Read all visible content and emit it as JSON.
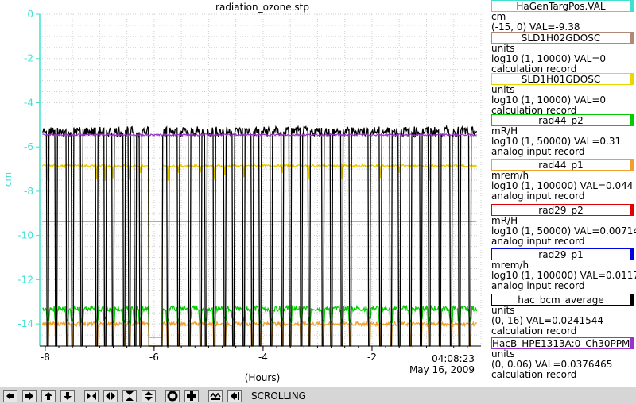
{
  "chart_data": {
    "type": "line",
    "title": "radiation_ozone.stp",
    "xlabel": "(Hours)",
    "ylabel": "cm",
    "xlim": [
      -8.1,
      0
    ],
    "ylim": [
      -15,
      0
    ],
    "x_ticks": [
      -8,
      -6,
      -4,
      -2
    ],
    "x_tick_labels": [
      "-8",
      "-6",
      "-4",
      "-2"
    ],
    "y_ticks": [
      0,
      -2,
      -4,
      -6,
      -8,
      -10,
      -12,
      -14
    ],
    "y_tick_labels": [
      "0",
      "-2",
      "-4",
      "-6",
      "-8",
      "-10",
      "-12",
      "-14"
    ],
    "axis_color": "#40e0d0",
    "end_time": "04:08:23",
    "end_date": "May 16, 2009",
    "grid": true,
    "legend_placement": "right",
    "drop_times": [
      -7.95,
      -7.8,
      -7.6,
      -7.5,
      -7.33,
      -7.05,
      -6.9,
      -6.75,
      -6.55,
      -6.45,
      -6.35,
      -6.25,
      -5.75,
      -5.55,
      -5.35,
      -5.15,
      -5.05,
      -4.9,
      -4.7,
      -4.55,
      -4.35,
      -4.2,
      -4.05,
      -3.85,
      -3.65,
      -3.5,
      -3.3,
      -3.15,
      -2.9,
      -2.75,
      -2.55,
      -2.4,
      -2.05,
      -1.85,
      -1.65,
      -1.5,
      -1.3,
      -1.1,
      -0.95,
      -0.75,
      -0.55,
      -0.4,
      -0.2
    ],
    "off_period": [
      -6.1,
      -5.85
    ],
    "series": [
      {
        "name": "HaGenTargPos.VAL",
        "color": "#40e0d0",
        "level": -9.38
      },
      {
        "name": "rad44_p2",
        "color": "#00cc00",
        "level": -13.3,
        "drop_level": -14.6
      },
      {
        "name": "rad44_p1",
        "color": "#f0a030",
        "level": -14.0,
        "drop_level": -15.0
      },
      {
        "name": "rad29_p2",
        "color": "#e8c800",
        "level": -6.85,
        "drop_level": -15.0
      },
      {
        "name": "hac_bcm_average",
        "color": "#000000",
        "level": -5.3,
        "drop_level": -15.0
      },
      {
        "name": "HacB_HPE1313A:0_Ch30PPM",
        "color": "#9933cc",
        "level": -5.45
      }
    ]
  },
  "legend": [
    {
      "name": "HaGenTargPos.VAL",
      "color": "#40e0d0",
      "units": "cm",
      "range": "(-15, 0) VAL=-9.38",
      "record": ""
    },
    {
      "name": "SLD1H02GDOSC",
      "color": "#b08878",
      "units": "units",
      "range": "log10 (1, 10000)  VAL=0",
      "record": "calculation record"
    },
    {
      "name": "SLD1H01GDOSC",
      "color": "#e8d800",
      "units": "units",
      "range": "log10 (1, 10000)  VAL=0",
      "record": "calculation record"
    },
    {
      "name": "rad44_p2",
      "color": "#00cc00",
      "units": "mR/H",
      "range": "log10 (1, 50000) VAL=0.31",
      "record": "analog input record"
    },
    {
      "name": "rad44_p1",
      "color": "#f0a030",
      "units": "mrem/h",
      "range": "log10 (1, 100000) VAL=0.044",
      "record": "analog input record"
    },
    {
      "name": "rad29_p2",
      "color": "#e00000",
      "units": "mR/H",
      "range": "log10 (1, 50000) VAL=0.00714",
      "record": "analog input record"
    },
    {
      "name": "rad29_p1",
      "color": "#0000e0",
      "units": "mrem/h",
      "range": "log10 (1, 100000) VAL=0.0117",
      "record": "analog input record"
    },
    {
      "name": "hac_bcm_average",
      "color": "#000000",
      "units": "units",
      "range": "(0, 16) VAL=0.0241544",
      "record": "calculation record"
    },
    {
      "name": "HacB_HPE1313A:0_Ch30PPM",
      "color": "#9933cc",
      "units": "units",
      "range": "(0, 0.06) VAL=0.0376465",
      "record": "calculation record"
    }
  ],
  "toolbar": {
    "mode_label": "SCROLLING",
    "buttons": [
      "arrow-left-icon",
      "arrow-right-icon",
      "arrow-up-icon",
      "arrow-down-icon",
      "zoom-in-horizontal-icon",
      "zoom-out-horizontal-icon",
      "zoom-in-vertical-icon",
      "zoom-out-vertical-icon",
      "circle-icon",
      "plus-icon",
      "scroll-mode-icon",
      "jump-to-end-icon"
    ]
  }
}
